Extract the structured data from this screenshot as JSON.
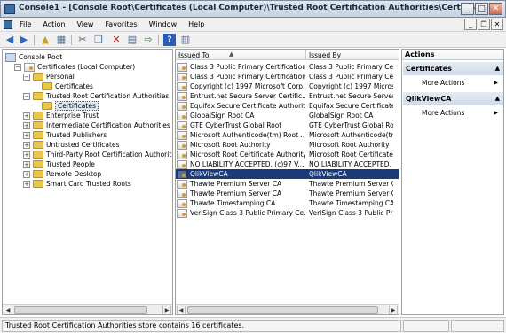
{
  "window": {
    "title": "Console1 - [Console Root\\Certificates (Local Computer)\\Trusted Root Certification Authorities\\Certificates]"
  },
  "menu": [
    "File",
    "Action",
    "View",
    "Favorites",
    "Window",
    "Help"
  ],
  "tree": {
    "items": [
      {
        "label": "Console Root",
        "level": 0,
        "expander": "",
        "icon": "console"
      },
      {
        "label": "Certificates (Local Computer)",
        "level": 1,
        "expander": "-",
        "icon": "cert"
      },
      {
        "label": "Personal",
        "level": 2,
        "expander": "-",
        "icon": "folder"
      },
      {
        "label": "Certificates",
        "level": 3,
        "expander": "",
        "icon": "folder"
      },
      {
        "label": "Trusted Root Certification Authorities",
        "level": 2,
        "expander": "-",
        "icon": "folder"
      },
      {
        "label": "Certificates",
        "level": 3,
        "expander": "",
        "icon": "folder",
        "selected": true
      },
      {
        "label": "Enterprise Trust",
        "level": 2,
        "expander": "+",
        "icon": "folder"
      },
      {
        "label": "Intermediate Certification Authorities",
        "level": 2,
        "expander": "+",
        "icon": "folder"
      },
      {
        "label": "Trusted Publishers",
        "level": 2,
        "expander": "+",
        "icon": "folder"
      },
      {
        "label": "Untrusted Certificates",
        "level": 2,
        "expander": "+",
        "icon": "folder"
      },
      {
        "label": "Third-Party Root Certification Authorities",
        "level": 2,
        "expander": "+",
        "icon": "folder"
      },
      {
        "label": "Trusted People",
        "level": 2,
        "expander": "+",
        "icon": "folder"
      },
      {
        "label": "Remote Desktop",
        "level": 2,
        "expander": "+",
        "icon": "folder"
      },
      {
        "label": "Smart Card Trusted Roots",
        "level": 2,
        "expander": "+",
        "icon": "folder"
      }
    ]
  },
  "list": {
    "headers": {
      "issued_to": "Issued To",
      "sort_indicator": "▲",
      "issued_by": "Issued By"
    },
    "rows": [
      {
        "issued_to": "Class 3 Public Primary Certification...",
        "issued_by": "Class 3 Public Primary Certif"
      },
      {
        "issued_to": "Class 3 Public Primary Certification...",
        "issued_by": "Class 3 Public Primary Certif"
      },
      {
        "issued_to": "Copyright (c) 1997 Microsoft Corp.",
        "issued_by": "Copyright (c) 1997 Microsoft"
      },
      {
        "issued_to": "Entrust.net Secure Server Certific...",
        "issued_by": "Entrust.net Secure Server Ce"
      },
      {
        "issued_to": "Equifax Secure Certificate Authority",
        "issued_by": "Equifax Secure Certificate A"
      },
      {
        "issued_to": "GlobalSign Root CA",
        "issued_by": "GlobalSign Root CA"
      },
      {
        "issued_to": "GTE CyberTrust Global Root",
        "issued_by": "GTE CyberTrust Global Root"
      },
      {
        "issued_to": "Microsoft Authenticode(tm) Root ...",
        "issued_by": "Microsoft Authenticode(tm)"
      },
      {
        "issued_to": "Microsoft Root Authority",
        "issued_by": "Microsoft Root Authority"
      },
      {
        "issued_to": "Microsoft Root Certificate Authority",
        "issued_by": "Microsoft Root Certificate A"
      },
      {
        "issued_to": "NO LIABILITY ACCEPTED, (c)97 V...",
        "issued_by": "NO LIABILITY ACCEPTED, (c"
      },
      {
        "issued_to": "QlikViewCA",
        "issued_by": "QlikViewCA",
        "selected": true
      },
      {
        "issued_to": "Thawte Premium Server CA",
        "issued_by": "Thawte Premium Server CA"
      },
      {
        "issued_to": "Thawte Premium Server CA",
        "issued_by": "Thawte Premium Server CA"
      },
      {
        "issued_to": "Thawte Timestamping CA",
        "issued_by": "Thawte Timestamping CA"
      },
      {
        "issued_to": "VeriSign Class 3 Public Primary Ce...",
        "issued_by": "VeriSign Class 3 Public Prim"
      }
    ]
  },
  "actions": {
    "title": "Actions",
    "sections": [
      {
        "label": "Certificates",
        "items": [
          "More Actions"
        ]
      },
      {
        "label": "QlikViewCA",
        "items": [
          "More Actions"
        ]
      }
    ]
  },
  "status": {
    "text": "Trusted Root Certification Authorities store contains 16 certificates."
  },
  "colors": {
    "selection": "#1a3a7a",
    "folder": "#e8c84a",
    "delete_icon": "#cc2222",
    "help_icon": "#2a5bb8"
  }
}
